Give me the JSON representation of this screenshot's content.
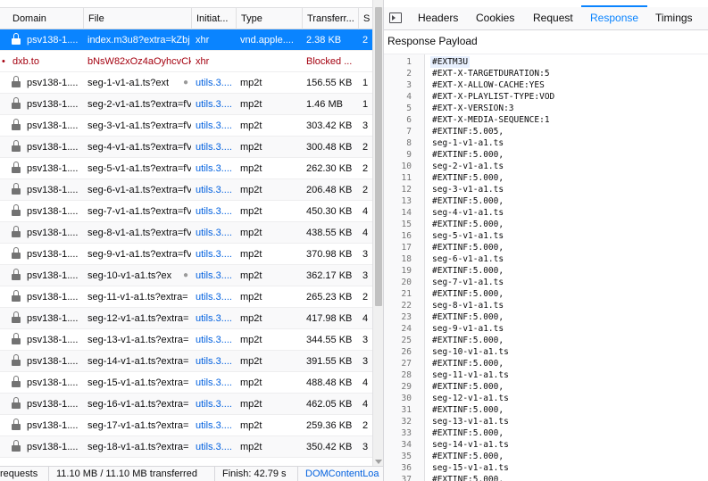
{
  "columns": {
    "domain": "Domain",
    "file": "File",
    "initiator": "Initiat...",
    "type": "Type",
    "transferred": "Transferr...",
    "cut": "S"
  },
  "requests": [
    {
      "domain": "psv138-1....",
      "file": "index.m3u8?extra=kZbj",
      "initiator": "xhr",
      "type": "vnd.apple....",
      "transferred": "2.38 KB",
      "cut": "2",
      "state": "selected",
      "secure": true
    },
    {
      "domain": "dxb.to",
      "file": "bNsW82xOz4aOyhcvCk",
      "initiator": "xhr",
      "type": "",
      "transferred": "Blocked ...",
      "cut": "",
      "state": "blocked",
      "secure": false,
      "prefix": "•"
    },
    {
      "domain": "psv138-1....",
      "file": "seg-1-v1-a1.ts?ext",
      "initiator": "utils.3....",
      "type": "mp2t",
      "transferred": "156.55 KB",
      "cut": "1",
      "secure": true,
      "slow": true
    },
    {
      "domain": "psv138-1....",
      "file": "seg-2-v1-a1.ts?extra=fV",
      "initiator": "utils.3....",
      "type": "mp2t",
      "transferred": "1.46 MB",
      "cut": "1",
      "secure": true
    },
    {
      "domain": "psv138-1....",
      "file": "seg-3-v1-a1.ts?extra=fV",
      "initiator": "utils.3....",
      "type": "mp2t",
      "transferred": "303.42 KB",
      "cut": "3",
      "secure": true
    },
    {
      "domain": "psv138-1....",
      "file": "seg-4-v1-a1.ts?extra=fV",
      "initiator": "utils.3....",
      "type": "mp2t",
      "transferred": "300.48 KB",
      "cut": "2",
      "secure": true
    },
    {
      "domain": "psv138-1....",
      "file": "seg-5-v1-a1.ts?extra=fV",
      "initiator": "utils.3....",
      "type": "mp2t",
      "transferred": "262.30 KB",
      "cut": "2",
      "secure": true
    },
    {
      "domain": "psv138-1....",
      "file": "seg-6-v1-a1.ts?extra=fV",
      "initiator": "utils.3....",
      "type": "mp2t",
      "transferred": "206.48 KB",
      "cut": "2",
      "secure": true
    },
    {
      "domain": "psv138-1....",
      "file": "seg-7-v1-a1.ts?extra=fV",
      "initiator": "utils.3....",
      "type": "mp2t",
      "transferred": "450.30 KB",
      "cut": "4",
      "secure": true
    },
    {
      "domain": "psv138-1....",
      "file": "seg-8-v1-a1.ts?extra=fV",
      "initiator": "utils.3....",
      "type": "mp2t",
      "transferred": "438.55 KB",
      "cut": "4",
      "secure": true
    },
    {
      "domain": "psv138-1....",
      "file": "seg-9-v1-a1.ts?extra=fV",
      "initiator": "utils.3....",
      "type": "mp2t",
      "transferred": "370.98 KB",
      "cut": "3",
      "secure": true
    },
    {
      "domain": "psv138-1....",
      "file": "seg-10-v1-a1.ts?ex",
      "initiator": "utils.3....",
      "type": "mp2t",
      "transferred": "362.17 KB",
      "cut": "3",
      "secure": true,
      "slow": true
    },
    {
      "domain": "psv138-1....",
      "file": "seg-11-v1-a1.ts?extra=",
      "initiator": "utils.3....",
      "type": "mp2t",
      "transferred": "265.23 KB",
      "cut": "2",
      "secure": true
    },
    {
      "domain": "psv138-1....",
      "file": "seg-12-v1-a1.ts?extra=",
      "initiator": "utils.3....",
      "type": "mp2t",
      "transferred": "417.98 KB",
      "cut": "4",
      "secure": true
    },
    {
      "domain": "psv138-1....",
      "file": "seg-13-v1-a1.ts?extra=",
      "initiator": "utils.3....",
      "type": "mp2t",
      "transferred": "344.55 KB",
      "cut": "3",
      "secure": true
    },
    {
      "domain": "psv138-1....",
      "file": "seg-14-v1-a1.ts?extra=",
      "initiator": "utils.3....",
      "type": "mp2t",
      "transferred": "391.55 KB",
      "cut": "3",
      "secure": true
    },
    {
      "domain": "psv138-1....",
      "file": "seg-15-v1-a1.ts?extra=",
      "initiator": "utils.3....",
      "type": "mp2t",
      "transferred": "488.48 KB",
      "cut": "4",
      "secure": true
    },
    {
      "domain": "psv138-1....",
      "file": "seg-16-v1-a1.ts?extra=",
      "initiator": "utils.3....",
      "type": "mp2t",
      "transferred": "462.05 KB",
      "cut": "4",
      "secure": true
    },
    {
      "domain": "psv138-1....",
      "file": "seg-17-v1-a1.ts?extra=",
      "initiator": "utils.3....",
      "type": "mp2t",
      "transferred": "259.36 KB",
      "cut": "2",
      "secure": true
    },
    {
      "domain": "psv138-1....",
      "file": "seg-18-v1-a1.ts?extra=",
      "initiator": "utils.3....",
      "type": "mp2t",
      "transferred": "350.42 KB",
      "cut": "3",
      "secure": true
    }
  ],
  "status": {
    "requests": "requests",
    "transferred": "11.10 MB / 11.10 MB transferred",
    "finish": "Finish: 42.79 s",
    "domcontent": "DOMContentLoa"
  },
  "details": {
    "tabs": [
      "Headers",
      "Cookies",
      "Request",
      "Response",
      "Timings"
    ],
    "active_tab": "Response",
    "payload_title": "Response Payload",
    "lines": [
      "#EXTM3U",
      "#EXT-X-TARGETDURATION:5",
      "#EXT-X-ALLOW-CACHE:YES",
      "#EXT-X-PLAYLIST-TYPE:VOD",
      "#EXT-X-VERSION:3",
      "#EXT-X-MEDIA-SEQUENCE:1",
      "#EXTINF:5.005,",
      "seg-1-v1-a1.ts",
      "#EXTINF:5.000,",
      "seg-2-v1-a1.ts",
      "#EXTINF:5.000,",
      "seg-3-v1-a1.ts",
      "#EXTINF:5.000,",
      "seg-4-v1-a1.ts",
      "#EXTINF:5.000,",
      "seg-5-v1-a1.ts",
      "#EXTINF:5.000,",
      "seg-6-v1-a1.ts",
      "#EXTINF:5.000,",
      "seg-7-v1-a1.ts",
      "#EXTINF:5.000,",
      "seg-8-v1-a1.ts",
      "#EXTINF:5.000,",
      "seg-9-v1-a1.ts",
      "#EXTINF:5.000,",
      "seg-10-v1-a1.ts",
      "#EXTINF:5.000,",
      "seg-11-v1-a1.ts",
      "#EXTINF:5.000,",
      "seg-12-v1-a1.ts",
      "#EXTINF:5.000,",
      "seg-13-v1-a1.ts",
      "#EXTINF:5.000,",
      "seg-14-v1-a1.ts",
      "#EXTINF:5.000,",
      "seg-15-v1-a1.ts",
      "#EXTINF:5.000,"
    ]
  },
  "colors": {
    "accent": "#0a84ff",
    "link": "#0060df",
    "blocked": "#a4000f"
  },
  "icons": {
    "lock": "lock-icon",
    "slow": "turtle-icon",
    "panel": "panel-toggle-icon"
  }
}
